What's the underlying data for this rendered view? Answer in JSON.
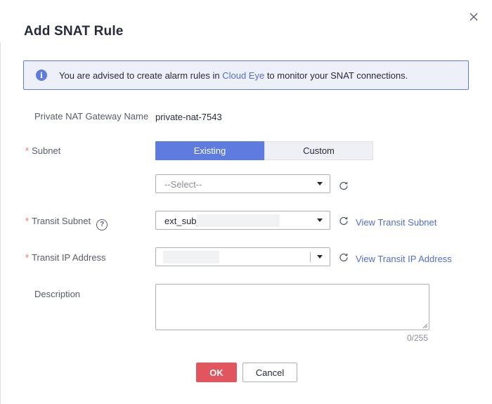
{
  "dialog": {
    "title": "Add SNAT Rule"
  },
  "notice": {
    "text_before": "You are advised to create alarm rules in ",
    "link_text": "Cloud Eye",
    "text_after": " to monitor your SNAT connections.",
    "icon": "info-icon"
  },
  "form": {
    "gateway": {
      "label": "Private NAT Gateway Name",
      "value": "private-nat-7543"
    },
    "subnet": {
      "required_mark": "*",
      "label": "Subnet",
      "options": [
        "Existing",
        "Custom"
      ],
      "selected": "Existing",
      "select_placeholder": "--Select--"
    },
    "transit_subnet": {
      "required_mark": "*",
      "label": "Transit Subnet",
      "help_icon": "?",
      "value": "ext_sub_",
      "link": "View Transit Subnet"
    },
    "transit_ip": {
      "required_mark": "*",
      "label": "Transit IP Address",
      "value": "",
      "link": "View Transit IP Address"
    },
    "description": {
      "label": "Description",
      "value": "",
      "counter": "0/255"
    }
  },
  "footer": {
    "ok_label": "OK",
    "cancel_label": "Cancel"
  },
  "colors": {
    "accent": "#5e7ce0",
    "danger": "#e1555e",
    "link": "#526ecc",
    "required": "#f66f6a"
  }
}
